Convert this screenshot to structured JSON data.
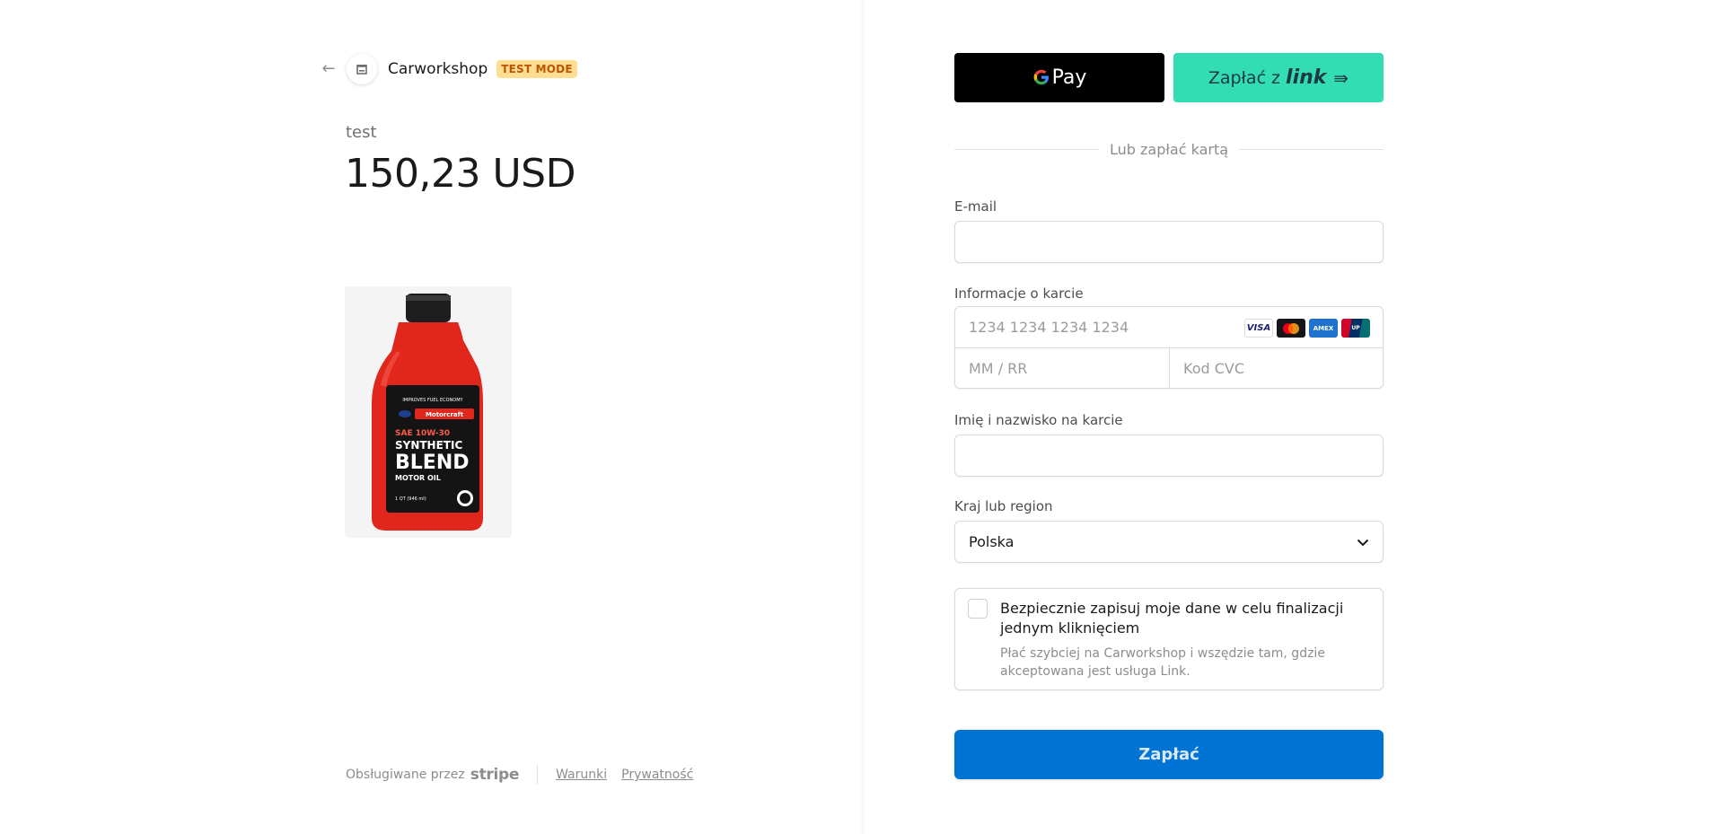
{
  "merchant": {
    "name": "Carworkshop",
    "test_badge": "TEST MODE"
  },
  "product": {
    "label": "test",
    "price": "150,23 USD",
    "image": {
      "brand": "Motorcraft",
      "line1": "SAE 10W-30",
      "line2": "SYNTHETIC",
      "line3": "BLEND",
      "line4": "MOTOR OIL",
      "top_text": "IMPROVES FUEL ECONOMY",
      "volume": "1 QT (946 ml)"
    }
  },
  "footer": {
    "powered_by": "Obsługiwane przez",
    "stripe": "stripe",
    "terms": "Warunki",
    "privacy": "Prywatność"
  },
  "wallets": {
    "gpay_label": "Pay",
    "link_prefix": "Zapłać z",
    "link_word": "link"
  },
  "divider_text": "Lub zapłać kartą",
  "form": {
    "email_label": "E-mail",
    "email_value": "",
    "card_label": "Informacje o karcie",
    "card_number_placeholder": "1234 1234 1234 1234",
    "expiry_placeholder": "MM / RR",
    "cvc_placeholder": "Kod CVC",
    "name_label": "Imię i nazwisko na karcie",
    "name_value": "",
    "country_label": "Kraj lub region",
    "country_value": "Polska",
    "card_brands": [
      "VISA",
      "mastercard",
      "AMERICAN EXPRESS",
      "UnionPay"
    ]
  },
  "save_info": {
    "title": "Bezpiecznie zapisuj moje dane w celu finalizacji jednym kliknięciem",
    "subtitle": "Płać szybciej na Carworkshop i wszędzie tam, gdzie akceptowana jest usługa Link.",
    "checked": false
  },
  "pay_button": "Zapłać",
  "colors": {
    "pay_button": "#0074d4",
    "link_button": "#33ddb3",
    "test_badge_bg": "#ffde92",
    "test_badge_text": "#bb5504"
  }
}
